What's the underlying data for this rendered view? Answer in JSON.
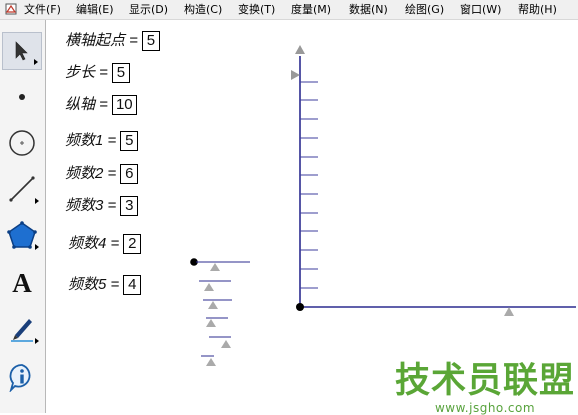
{
  "menu": [
    "文件(F)",
    "编辑(E)",
    "显示(D)",
    "构造(C)",
    "变换(T)",
    "度量(M)",
    "数据(N)",
    "绘图(G)",
    "窗口(W)",
    "帮助(H)"
  ],
  "tools": [
    "arrow-select-icon",
    "point-icon",
    "compass-circle-icon",
    "straightedge-line-icon",
    "polygon-icon",
    "text-A-icon",
    "marker-pen-icon",
    "info-icon"
  ],
  "tool_labels": {
    "text": "A"
  },
  "params": [
    {
      "label": "横轴起点 =",
      "value": "5"
    },
    {
      "label": "步长 =",
      "value": "5"
    },
    {
      "label": "纵轴 =",
      "value": "10"
    },
    {
      "label": "频数1 =",
      "value": "5"
    },
    {
      "label": "频数2 =",
      "value": "6"
    },
    {
      "label": "频数3 =",
      "value": "3"
    },
    {
      "label": "频数4 =",
      "value": "2"
    },
    {
      "label": "频数5 =",
      "value": "4"
    }
  ],
  "watermark": {
    "title": "技术员联盟",
    "url": "www.jsgho.com"
  },
  "colors": {
    "axis": "#2b2b8f",
    "tick": "#3d3d9c",
    "marker": "#aaaaaa",
    "watermark": "#5aa636"
  }
}
